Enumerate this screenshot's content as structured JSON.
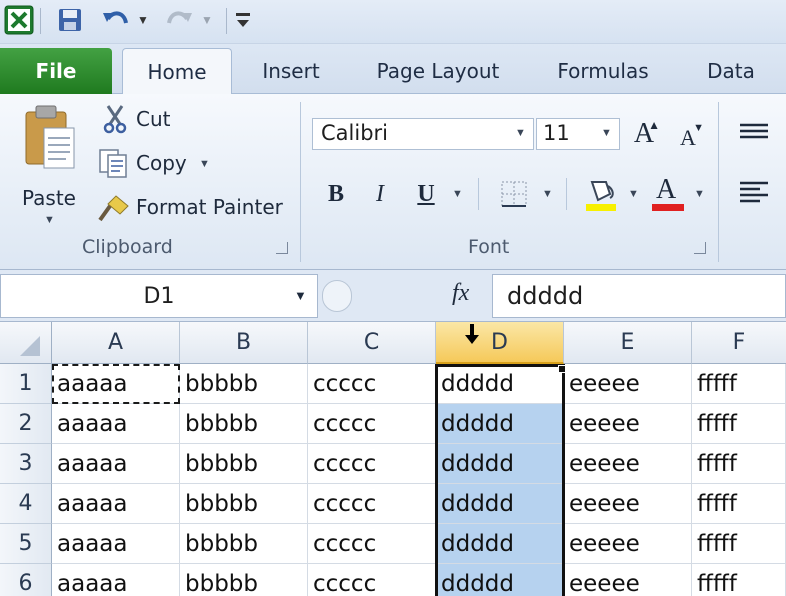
{
  "tabs": [
    "File",
    "Home",
    "Insert",
    "Page Layout",
    "Formulas",
    "Data"
  ],
  "clipboard": {
    "paste_label": "Paste",
    "cut_label": "Cut",
    "copy_label": "Copy",
    "format_painter_label": "Format Painter",
    "group_label": "Clipboard"
  },
  "font": {
    "font_name": "Calibri",
    "font_size": "11",
    "group_label": "Font",
    "bold_label": "B",
    "italic_label": "I",
    "underline_label": "U",
    "font_color_glyph": "A",
    "grow_glyph": "A",
    "shrink_glyph": "A",
    "highlight_color": "#f7f000",
    "font_color": "#e02020"
  },
  "formula_bar": {
    "name_box": "D1",
    "fx_label": "fx",
    "value": "ddddd"
  },
  "columns": [
    "A",
    "B",
    "C",
    "D",
    "E",
    "F"
  ],
  "selected_column": "D",
  "rows": [
    {
      "num": "1",
      "cells": [
        "aaaaa",
        "bbbbb",
        "ccccc",
        "ddddd",
        "eeeee",
        "fffff"
      ]
    },
    {
      "num": "2",
      "cells": [
        "aaaaa",
        "bbbbb",
        "ccccc",
        "ddddd",
        "eeeee",
        "fffff"
      ]
    },
    {
      "num": "3",
      "cells": [
        "aaaaa",
        "bbbbb",
        "ccccc",
        "ddddd",
        "eeeee",
        "fffff"
      ]
    },
    {
      "num": "4",
      "cells": [
        "aaaaa",
        "bbbbb",
        "ccccc",
        "ddddd",
        "eeeee",
        "fffff"
      ]
    },
    {
      "num": "5",
      "cells": [
        "aaaaa",
        "bbbbb",
        "ccccc",
        "ddddd",
        "eeeee",
        "fffff"
      ]
    },
    {
      "num": "6",
      "cells": [
        "aaaaa",
        "bbbbb",
        "ccccc",
        "ddddd",
        "eeeee",
        "fffff"
      ]
    }
  ],
  "icons": {
    "app": "excel-icon",
    "save": "save-icon",
    "undo": "undo-icon",
    "redo": "redo-icon",
    "customize": "customize-qat-icon",
    "paste": "paste-icon",
    "cut": "scissors-icon",
    "copy": "copy-icon",
    "format_painter": "paintbrush-icon",
    "select_all": "select-all-icon",
    "select_column_cursor": "down-arrow-cursor-icon"
  }
}
